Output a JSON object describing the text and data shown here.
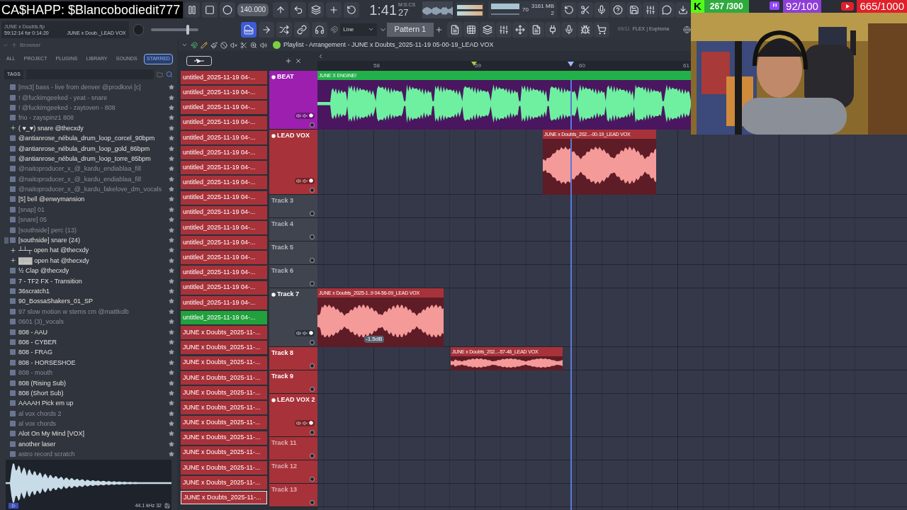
{
  "overlay": {
    "donation": "CA$HAPP: $Blancobodiedit777",
    "goals": [
      {
        "kind": "kick",
        "icon": "K",
        "count": "267 /300"
      },
      {
        "kind": "twitch",
        "count": "92/100"
      },
      {
        "kind": "youtube",
        "count": "665/1000"
      }
    ]
  },
  "toolbar": {
    "master_slider": {
      "level": 0.8
    },
    "tempo": "140.000",
    "time": "1:41",
    "time_cs": "27",
    "time_unit": "M:S:CS",
    "cpu": "70",
    "memory": "3161 MB",
    "polyphony": "2",
    "project_file": "JUNE x Doubts.flp",
    "project_time": "59:12:14 for 0:14:20",
    "hint": "JUNE x Doub._LEAD VOX",
    "snap": "Line",
    "pattern": "Pattern 1",
    "news_count": "09/11",
    "news": "FLEX | Euphona"
  },
  "browser": {
    "title": "Browser",
    "tabs": [
      {
        "label": "ALL",
        "selected": false
      },
      {
        "label": "PROJECT",
        "selected": false
      },
      {
        "label": "PLUGINS",
        "selected": false
      },
      {
        "label": "LIBRARY",
        "selected": false
      },
      {
        "label": "SOUNDS",
        "selected": false
      },
      {
        "label": "STARRED",
        "selected": true
      }
    ],
    "tags_label": "TAGS",
    "items": [
      {
        "label": "[ms3] bass - live from denver @prodkxvi [c]",
        "kind": "file",
        "dim": true
      },
      {
        "label": "! @fuckimgeeked - yeat - snare",
        "kind": "file",
        "dim": true
      },
      {
        "label": "! @fuckimgeeked - zaytoven - 808",
        "kind": "file",
        "dim": true
      },
      {
        "label": "frio - zayspinz1 808",
        "kind": "file",
        "dim": true
      },
      {
        "label": "( ♥_♥) snare @thecxdy",
        "kind": "folder",
        "dim": false
      },
      {
        "label": "@antianrose_nébula_drum_loop_corcel_90bpm",
        "kind": "file",
        "dim": false
      },
      {
        "label": "@antianrose_nébula_drum_loop_gold_86bpm",
        "kind": "file",
        "dim": false
      },
      {
        "label": "@antianrose_nébula_drum_loop_torre_85bpm",
        "kind": "file",
        "dim": false
      },
      {
        "label": "@naitoproducer_x_@_kardu_endiablaa_fill",
        "kind": "file",
        "dim": true
      },
      {
        "label": "@naitoproducer_x_@_kardu_endiablaa_fill",
        "kind": "file",
        "dim": true
      },
      {
        "label": "@naitoproducer_x_@_kardu_fakelove_dm_vocals",
        "kind": "file",
        "dim": true
      },
      {
        "label": "[5] bell @enwymansion",
        "kind": "file",
        "dim": false
      },
      {
        "label": "[snap] 01",
        "kind": "file",
        "dim": true
      },
      {
        "label": "[snare] 05",
        "kind": "file",
        "dim": true
      },
      {
        "label": "[southside] perc (13)",
        "kind": "file",
        "dim": true
      },
      {
        "label": "[southside] snare (24)",
        "kind": "pack",
        "dim": false
      },
      {
        "label": "┴┴┬ open hat @thecxdy",
        "kind": "folder",
        "dim": false
      },
      {
        "label": "▓▓▓ open hat @thecxdy",
        "kind": "folder",
        "dim": false
      },
      {
        "label": "½ Clap @thecxdy",
        "kind": "file",
        "dim": false
      },
      {
        "label": "7 - TF2 FX - Transition",
        "kind": "file",
        "dim": false
      },
      {
        "label": "36scratch1",
        "kind": "file",
        "dim": false
      },
      {
        "label": "90_BossaShakers_01_SP",
        "kind": "file",
        "dim": false
      },
      {
        "label": "97 slow motion w stems cm @mattkolb",
        "kind": "file",
        "dim": true
      },
      {
        "label": "0601 (3)_vocals",
        "kind": "file",
        "dim": true
      },
      {
        "label": "808 - AAU",
        "kind": "file",
        "dim": false
      },
      {
        "label": "808 - CYBER",
        "kind": "file",
        "dim": false
      },
      {
        "label": "808 - FRAG",
        "kind": "file",
        "dim": false
      },
      {
        "label": "808 - HORSESHOE",
        "kind": "file",
        "dim": false
      },
      {
        "label": "808 - mouth",
        "kind": "file",
        "dim": true
      },
      {
        "label": "808 (Rising Sub)",
        "kind": "file",
        "dim": false
      },
      {
        "label": "808 (Short Sub)",
        "kind": "file",
        "dim": false
      },
      {
        "label": "AAAAH Pick em up",
        "kind": "file",
        "dim": false
      },
      {
        "label": "al vox chords 2",
        "kind": "file",
        "dim": true
      },
      {
        "label": "al vox chords",
        "kind": "file",
        "dim": true
      },
      {
        "label": "Alot On My Mind [VOX]",
        "kind": "file",
        "dim": false
      },
      {
        "label": "another laser",
        "kind": "file",
        "dim": false
      },
      {
        "label": "astro record scratch",
        "kind": "file",
        "dim": true
      }
    ],
    "sample_info": "44.1 kHz 32"
  },
  "playlist": {
    "title": "Playlist - Arrangement - JUNE x Doubts_2025-11-19 05-00-19_LEAD VOX",
    "clip_list": [
      {
        "label": "untitled_2025-11-19 04-...",
        "selected": false,
        "focused": false
      },
      {
        "label": "untitled_2025-11-19 04-...",
        "selected": false,
        "focused": false
      },
      {
        "label": "untitled_2025-11-19 04-...",
        "selected": false,
        "focused": false
      },
      {
        "label": "untitled_2025-11-19 04-...",
        "selected": false,
        "focused": false
      },
      {
        "label": "untitled_2025-11-19 04-...",
        "selected": false,
        "focused": false
      },
      {
        "label": "untitled_2025-11-19 04-...",
        "selected": false,
        "focused": false
      },
      {
        "label": "untitled_2025-11-19 04-...",
        "selected": false,
        "focused": false
      },
      {
        "label": "untitled_2025-11-19 04-...",
        "selected": false,
        "focused": false
      },
      {
        "label": "untitled_2025-11-19 04-...",
        "selected": false,
        "focused": false
      },
      {
        "label": "untitled_2025-11-19 04-...",
        "selected": false,
        "focused": false
      },
      {
        "label": "untitled_2025-11-19 04-...",
        "selected": false,
        "focused": false
      },
      {
        "label": "untitled_2025-11-19 04-...",
        "selected": false,
        "focused": false
      },
      {
        "label": "untitled_2025-11-19 04-...",
        "selected": false,
        "focused": false
      },
      {
        "label": "untitled_2025-11-19 04-...",
        "selected": false,
        "focused": false
      },
      {
        "label": "untitled_2025-11-19 04-...",
        "selected": false,
        "focused": false
      },
      {
        "label": "untitled_2025-11-19 04-...",
        "selected": false,
        "focused": false
      },
      {
        "label": "untitled_2025-11-19 04-...",
        "selected": true,
        "focused": false
      },
      {
        "label": "JUNE x Doubts_2025-11-...",
        "selected": false,
        "focused": false
      },
      {
        "label": "JUNE x Doubts_2025-11-...",
        "selected": false,
        "focused": false
      },
      {
        "label": "JUNE x Doubts_2025-11-...",
        "selected": false,
        "focused": false
      },
      {
        "label": "JUNE x Doubts_2025-11-...",
        "selected": false,
        "focused": false
      },
      {
        "label": "JUNE x Doubts_2025-11-...",
        "selected": false,
        "focused": false
      },
      {
        "label": "JUNE x Doubts_2025-11-...",
        "selected": false,
        "focused": false
      },
      {
        "label": "JUNE x Doubts_2025-11-...",
        "selected": false,
        "focused": false
      },
      {
        "label": "JUNE x Doubts_2025-11-...",
        "selected": false,
        "focused": false
      },
      {
        "label": "JUNE x Doubts_2025-11-...",
        "selected": false,
        "focused": false
      },
      {
        "label": "JUNE x Doubts_2025-11-...",
        "selected": false,
        "focused": false
      },
      {
        "label": "JUNE x Doubts_2025-11-...",
        "selected": false,
        "focused": false
      },
      {
        "label": "JUNE x Doubts_2025-11-...",
        "selected": false,
        "focused": true
      }
    ],
    "ruler": [
      "58",
      "59",
      "60",
      "61"
    ],
    "tracks": [
      {
        "name": "BEAT",
        "color": "#9c1fb0",
        "empty": false,
        "controls": true,
        "clips": [
          {
            "label": "JUNE X ENGINE!",
            "kind": "beat"
          }
        ]
      },
      {
        "name": "LEAD VOX",
        "color": "#a8323a",
        "empty": false,
        "controls": true,
        "clips": [
          {
            "label": "JUNE x Doubts_202...-00-19_LEAD VOX",
            "kind": "vocal"
          }
        ]
      },
      {
        "name": "Track 3",
        "color": "#40444f",
        "empty": true,
        "controls": false
      },
      {
        "name": "Track 4",
        "color": "#40444f",
        "empty": true,
        "controls": false
      },
      {
        "name": "Track 5",
        "color": "#40444f",
        "empty": true,
        "controls": false
      },
      {
        "name": "Track 6",
        "color": "#40444f",
        "empty": true,
        "controls": false
      },
      {
        "name": "Track 7",
        "color": "#40444f",
        "empty": false,
        "controls": true,
        "clips": [
          {
            "label": "JUNE x Doubts_2025-1..9 04-56-09_LEAD VOX",
            "kind": "vocal",
            "gain": "-1.5dB"
          }
        ]
      },
      {
        "name": "Track 8",
        "color": "#a8323a",
        "empty": false,
        "controls": false,
        "clips": [
          {
            "label": "JUNE x Doubts_202...-57-46_LEAD VOX",
            "kind": "vocal"
          }
        ]
      },
      {
        "name": "Track 9",
        "color": "#a8323a",
        "empty": false,
        "controls": false
      },
      {
        "name": "LEAD VOX 2",
        "color": "#a8323a",
        "empty": false,
        "controls": true
      },
      {
        "name": "Track 11",
        "color": "#a8323a",
        "empty": true,
        "controls": false
      },
      {
        "name": "Track 12",
        "color": "#a8323a",
        "empty": true,
        "controls": false
      },
      {
        "name": "Track 13",
        "color": "#a8323a",
        "empty": true,
        "controls": false
      }
    ]
  }
}
